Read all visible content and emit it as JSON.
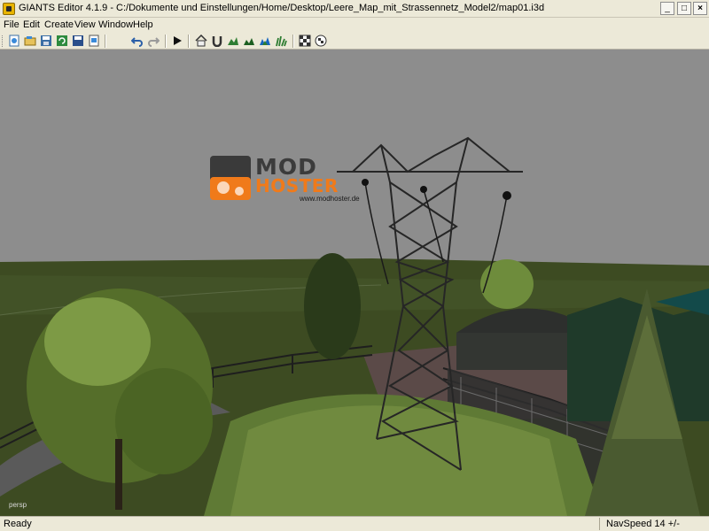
{
  "window": {
    "title": "GIANTS Editor 4.1.9 - C:/Dokumente und Einstellungen/Home/Desktop/Leere_Map_mit_Strassennetz_Model2/map01.i3d",
    "minimize_glyph": "_",
    "maximize_glyph": "□",
    "close_glyph": "×"
  },
  "menu": [
    {
      "label": "File"
    },
    {
      "label": "Edit"
    },
    {
      "label": "Create"
    },
    {
      "label": "View"
    },
    {
      "label": "Window"
    },
    {
      "label": "Help"
    }
  ],
  "toolbar": {
    "icons": [
      "new-file-icon",
      "open-file-icon",
      "save-icon",
      "refresh-icon",
      "save-as-icon",
      "import-icon",
      "undo-icon",
      "redo-icon",
      "play-icon",
      "home-icon",
      "magnet-icon",
      "terrain-sculpt-icon",
      "terrain-paint-icon",
      "foliage-paint-icon",
      "grass-icon",
      "checker-icon",
      "checker-target-icon"
    ]
  },
  "viewport": {
    "camera_label": "persp",
    "watermark": {
      "line1": "MOD",
      "line2": "HOSTER",
      "url": "www.modhoster.de"
    },
    "colors": {
      "sky": "#8c8c8c",
      "grass": "#3a4a22",
      "tower": "#2b2b2b",
      "accent_orange": "#f07a1a"
    }
  },
  "status": {
    "text": "Ready",
    "navspeed": "NavSpeed 14 +/-"
  }
}
